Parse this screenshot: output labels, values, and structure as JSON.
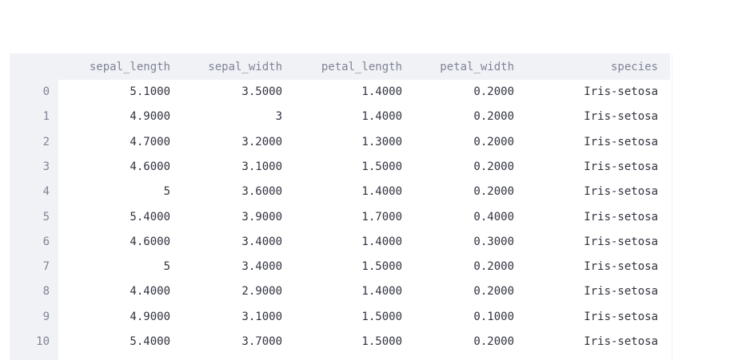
{
  "table": {
    "columns": [
      "sepal_length",
      "sepal_width",
      "petal_length",
      "petal_width",
      "species"
    ],
    "index": [
      "0",
      "1",
      "2",
      "3",
      "4",
      "5",
      "6",
      "7",
      "8",
      "9",
      "10"
    ],
    "rows": [
      [
        "5.1000",
        "3.5000",
        "1.4000",
        "0.2000",
        "Iris-setosa"
      ],
      [
        "4.9000",
        "3",
        "1.4000",
        "0.2000",
        "Iris-setosa"
      ],
      [
        "4.7000",
        "3.2000",
        "1.3000",
        "0.2000",
        "Iris-setosa"
      ],
      [
        "4.6000",
        "3.1000",
        "1.5000",
        "0.2000",
        "Iris-setosa"
      ],
      [
        "5",
        "3.6000",
        "1.4000",
        "0.2000",
        "Iris-setosa"
      ],
      [
        "5.4000",
        "3.9000",
        "1.7000",
        "0.4000",
        "Iris-setosa"
      ],
      [
        "4.6000",
        "3.4000",
        "1.4000",
        "0.3000",
        "Iris-setosa"
      ],
      [
        "5",
        "3.4000",
        "1.5000",
        "0.2000",
        "Iris-setosa"
      ],
      [
        "4.4000",
        "2.9000",
        "1.4000",
        "0.2000",
        "Iris-setosa"
      ],
      [
        "4.9000",
        "3.1000",
        "1.5000",
        "0.1000",
        "Iris-setosa"
      ],
      [
        "5.4000",
        "3.7000",
        "1.5000",
        "0.2000",
        "Iris-setosa"
      ]
    ]
  },
  "colors": {
    "header_bg": "#f0f2f6",
    "header_text": "#808495",
    "cell_text": "#31333f"
  }
}
